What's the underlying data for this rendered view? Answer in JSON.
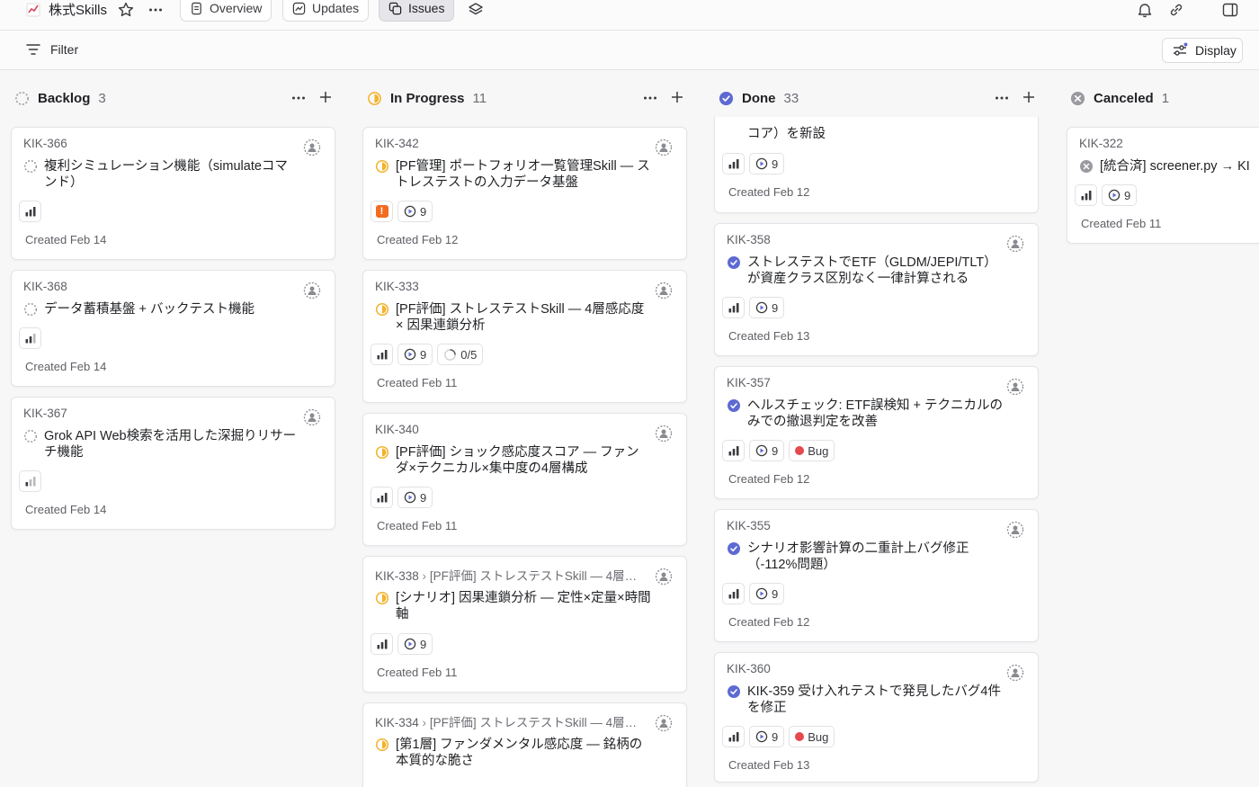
{
  "project": {
    "icon": "chart-emoji-icon",
    "name": "株式Skills"
  },
  "tabs": [
    {
      "label": "Overview"
    },
    {
      "label": "Updates"
    },
    {
      "label": "Issues"
    }
  ],
  "toolbar": {
    "filter_label": "Filter",
    "display_label": "Display"
  },
  "columns": [
    {
      "title": "Backlog",
      "count": "3"
    },
    {
      "title": "In Progress",
      "count": "11"
    },
    {
      "title": "Done",
      "count": "33"
    },
    {
      "title": "Canceled",
      "count": "1"
    }
  ],
  "backlog": [
    {
      "id": "KIK-366",
      "title": "複利シミュレーション機能（simulateコマンド）",
      "created": "Created Feb 14"
    },
    {
      "id": "KIK-368",
      "title": "データ蓄積基盤 + バックテスト機能",
      "created": "Created Feb 14"
    },
    {
      "id": "KIK-367",
      "title": "Grok API Web検索を活用した深掘りリサーチ機能",
      "created": "Created Feb 14"
    }
  ],
  "in_progress": [
    {
      "id": "KIK-342",
      "title": "[PF管理] ポートフォリオ一覧管理Skill — ストレステストの入力データ基盤",
      "cycle": "9",
      "created": "Created Feb 12"
    },
    {
      "id": "KIK-333",
      "title": "[PF評価] ストレステストSkill — 4層感応度 × 因果連鎖分析",
      "cycle": "9",
      "subissues": "0/5",
      "created": "Created Feb 11"
    },
    {
      "id": "KIK-340",
      "title": "[PF評価] ショック感応度スコア — ファンダ×テクニカル×集中度の4層構成",
      "cycle": "9",
      "created": "Created Feb 11"
    },
    {
      "id": "KIK-338",
      "parent": "[PF評価] ストレステストSkill — 4層…",
      "title": "[シナリオ] 因果連鎖分析 — 定性×定量×時間軸",
      "cycle": "9",
      "created": "Created Feb 11"
    },
    {
      "id": "KIK-334",
      "parent": "[PF評価] ストレステストSkill — 4層…",
      "title": "[第1層] ファンダメンタル感応度 — 銘柄の本質的な脆さ"
    }
  ],
  "done": [
    {
      "title_tail": "コア）を新設",
      "cycle": "9",
      "created": "Created Feb 12"
    },
    {
      "id": "KIK-358",
      "title": "ストレステストでETF（GLDM/JEPI/TLT）が資産クラス区別なく一律計算される",
      "cycle": "9",
      "created": "Created Feb 13"
    },
    {
      "id": "KIK-357",
      "title": "ヘルスチェック: ETF誤検知 + テクニカルのみでの撤退判定を改善",
      "cycle": "9",
      "label": "Bug",
      "created": "Created Feb 12"
    },
    {
      "id": "KIK-355",
      "title": "シナリオ影響計算の二重計上バグ修正（-112%問題）",
      "cycle": "9",
      "created": "Created Feb 12"
    },
    {
      "id": "KIK-360",
      "title": "KIK-359 受け入れテストで発見したバグ4件を修正",
      "cycle": "9",
      "label": "Bug",
      "created": "Created Feb 13"
    }
  ],
  "canceled": [
    {
      "id": "KIK-322",
      "title": "[統合済] screener.py → KI",
      "cycle": "9",
      "created": "Created Feb 11"
    }
  ],
  "colors": {
    "backlog": "#9a9aa0",
    "in_progress": "#f2b32a",
    "done": "#5e6ad2",
    "canceled": "#9a9aa0",
    "bug": "#e5484d",
    "urgent": "#f26b21"
  }
}
